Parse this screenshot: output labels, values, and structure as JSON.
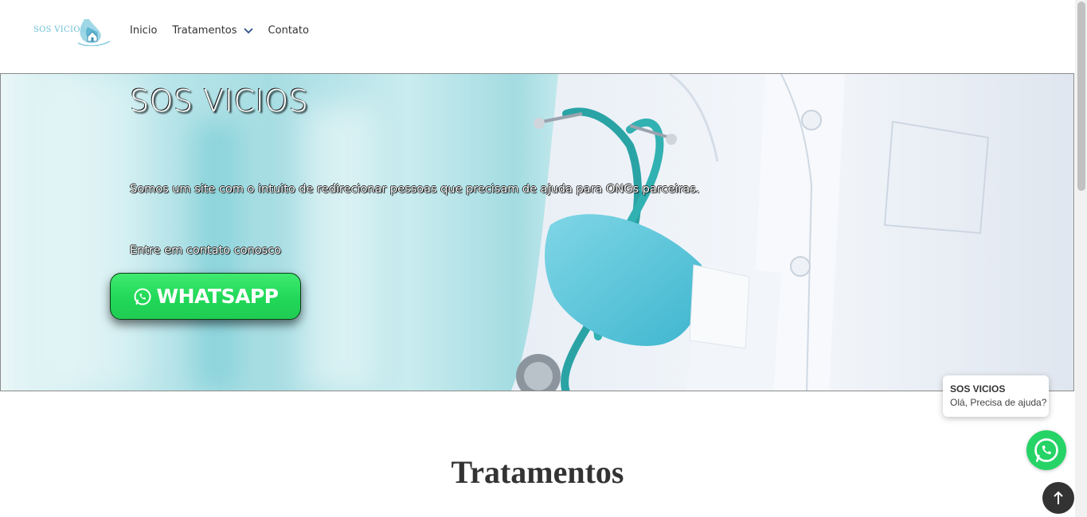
{
  "header": {
    "logo_text": "SOS VICIOS",
    "nav": [
      {
        "label": "Inicio"
      },
      {
        "label": "Tratamentos",
        "has_dropdown": true
      },
      {
        "label": "Contato"
      }
    ]
  },
  "hero": {
    "title": "SOS VICIOS",
    "description": "Somos um site com o intuito de redirecionar pessoas que precisam de ajuda para ONGs parceiras.",
    "contact_text": "Entre em contato conosco",
    "whatsapp_button_label": "WHATSAPP",
    "whatsapp_icon": "whatsapp-icon"
  },
  "chat_popup": {
    "title": "SOS VICIOS",
    "message": "Olá, Precisa de ajuda?"
  },
  "sections": {
    "tratamentos_title": "Tratamentos"
  },
  "icons": {
    "float_whatsapp": "whatsapp-icon",
    "back_to_top": "arrow-up-icon",
    "dropdown": "chevron-down-icon"
  },
  "colors": {
    "whatsapp_green": "#25d366",
    "logo_blue": "#6bbfd6",
    "back_to_top_bg": "#333333"
  }
}
